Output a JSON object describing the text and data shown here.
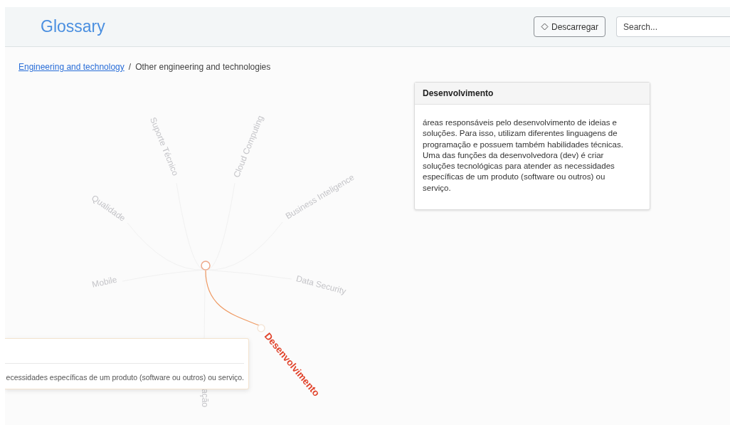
{
  "header": {
    "title": "Glossary",
    "download_button": "Descarregar",
    "search": {
      "placeholder": "Search..."
    }
  },
  "breadcrumb": {
    "separator": "/",
    "items": [
      {
        "label": "Engineering and technology",
        "kind": "link"
      },
      {
        "label": "Other engineering and technologies",
        "kind": "current"
      }
    ]
  },
  "graph": {
    "nodes": [
      {
        "label": "Suporte Técnico",
        "selected": false
      },
      {
        "label": "Cloud Computing",
        "selected": false
      },
      {
        "label": "Business Inteligence",
        "selected": false
      },
      {
        "label": "Qualidade",
        "selected": false
      },
      {
        "label": "Mobile",
        "selected": false
      },
      {
        "label": "Data Security",
        "selected": false
      },
      {
        "label": "ação",
        "selected": false
      },
      {
        "label": "Desenvolvimento",
        "selected": true
      }
    ]
  },
  "tooltip": {
    "text": "ecessidades específicas de um produto (software ou outros) ou serviço."
  },
  "definition_card": {
    "title": "Desenvolvimento",
    "body": "áreas responsáveis pelo desenvolvimento de ideias e soluções. Para isso, utilizam diferentes linguagens de programação e possuem também habilidades técnicas. Uma das funções da desenvolvedora (dev) é criar soluções tecnológicas para atender as necessidades específicas de um produto (software ou outros) ou serviço."
  }
}
